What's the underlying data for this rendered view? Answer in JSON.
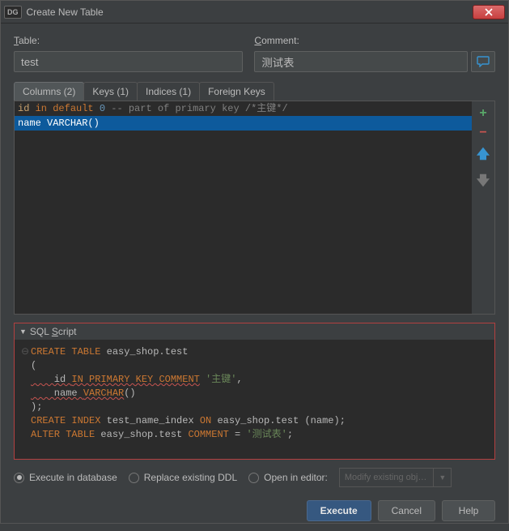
{
  "window": {
    "app_icon": "DG",
    "title": "Create New Table"
  },
  "form": {
    "table_label_pre": "T",
    "table_label_post": "able:",
    "table_value": "test",
    "comment_label_pre": "C",
    "comment_label_post": "omment:",
    "comment_value": "测试表"
  },
  "tabs": {
    "columns": "Columns (2)",
    "keys": "Keys (1)",
    "indices": "Indices (1)",
    "fkeys": "Foreign Keys"
  },
  "columns": {
    "row1": {
      "name": "id",
      "kw1": "in",
      "kw2": "default",
      "num": "0",
      "cmt": " -- part of primary key /*主键*/"
    },
    "row2": {
      "name": "name",
      "type": "VARCHAR()"
    }
  },
  "sql_header": {
    "pre": "SQL ",
    "ul": "S",
    "post": "cript"
  },
  "sql": {
    "l1_kw": "CREATE TABLE",
    "l1_id": " easy_shop.test",
    "l2": "(",
    "l3_id": "    id ",
    "l3_kw": "IN PRIMARY KEY COMMENT",
    "l3_str": " '主键'",
    "l3_p": ",",
    "l4_id": "    name ",
    "l4_kw": "VARCHAR",
    "l4_p": "()",
    "l5": ");",
    "l6_kw1": "CREATE INDEX",
    "l6_id1": " test_name_index ",
    "l6_kw2": "ON",
    "l6_id2": " easy_shop.test (name)",
    "l6_p": ";",
    "l7_kw1": "ALTER TABLE",
    "l7_id": " easy_shop.test ",
    "l7_kw2": "COMMENT",
    "l7_eq": " = ",
    "l7_str": "'测试表'",
    "l7_p": ";"
  },
  "options": {
    "execute_db": "Execute in database",
    "replace": "Replace existing DDL",
    "open_editor": "Open in editor:",
    "combo": "Modify existing obj…"
  },
  "buttons": {
    "execute": "Execute",
    "cancel": "Cancel",
    "help": "Help"
  }
}
